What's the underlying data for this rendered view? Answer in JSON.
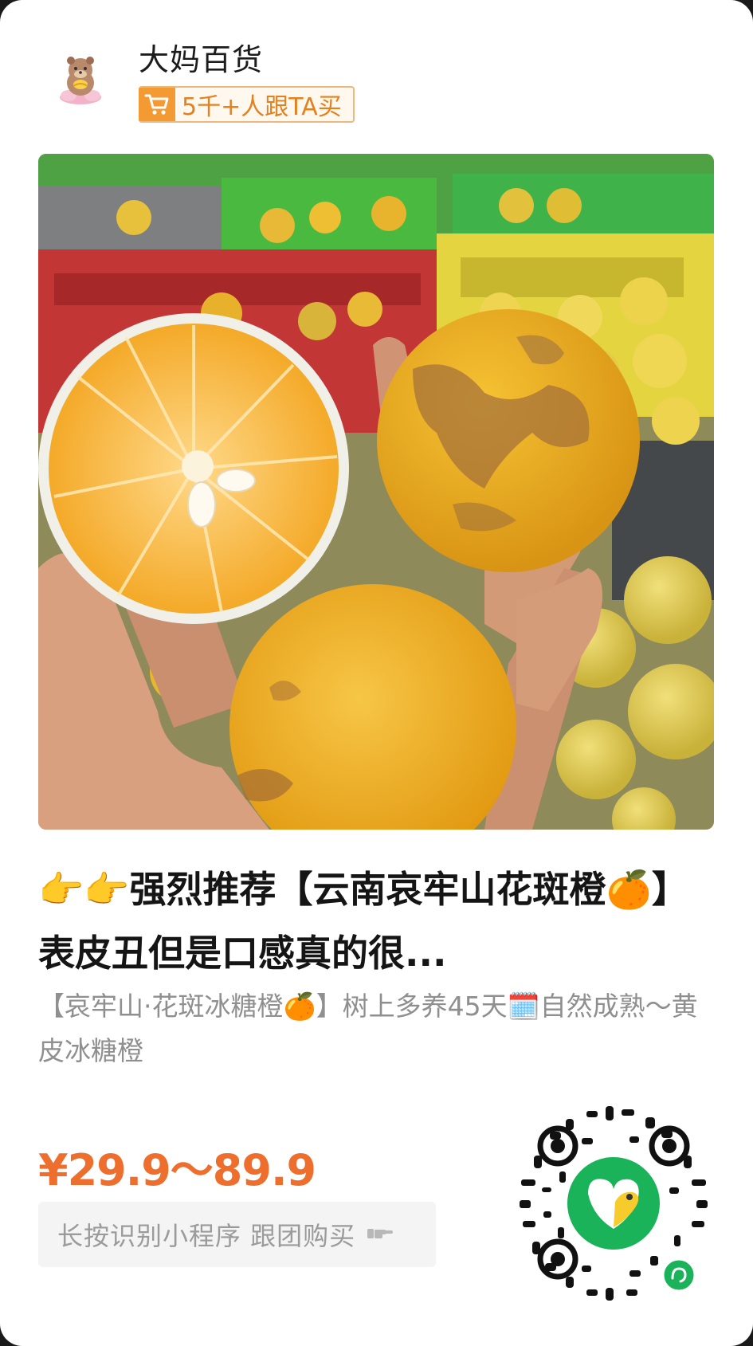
{
  "shop": {
    "name": "大妈百货",
    "avatar_icon": "bear-mascot-avatar",
    "follow_badge": "5千+人跟TA买",
    "cart_icon": "shopping-cart-icon"
  },
  "product": {
    "image_desc_icon": "orange-product-photo",
    "title": "👉👉强烈推荐【云南哀牢山花斑橙🍊】表皮丑但是口感真的很...",
    "subtitle": "【哀牢山·花斑冰糖橙🍊】树上多养45天🗓️自然成熟～黄皮冰糖橙",
    "price": "¥29.9～89.9"
  },
  "cta": {
    "label": "长按识别小程序 跟团购买",
    "arrow_icon": "hand-point-right-icon"
  },
  "qr": {
    "icon": "mini-program-qr-code"
  },
  "colors": {
    "accent_orange": "#ee6f2d",
    "badge_orange": "#f39a33",
    "subtitle_gray": "#8f8f8f"
  }
}
